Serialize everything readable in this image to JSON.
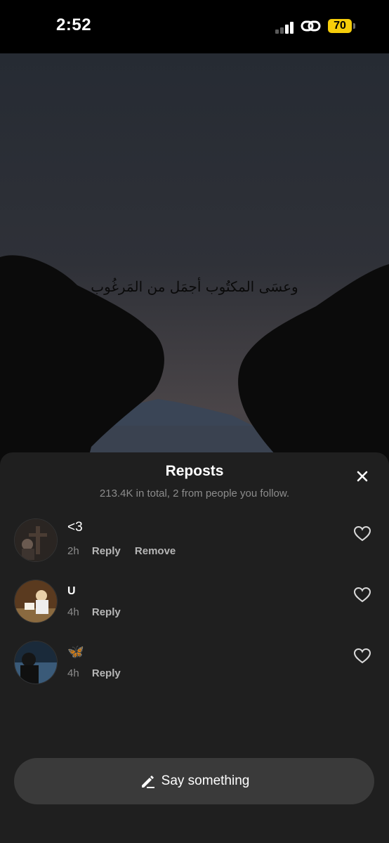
{
  "status_bar": {
    "time": "2:52",
    "battery": "70",
    "icons": [
      "signal-icon",
      "link-icon",
      "battery-icon"
    ]
  },
  "video": {
    "caption": "وعسَى المكتُوب أجمَل من المَرغُوب"
  },
  "sheet": {
    "title": "Reposts",
    "subtitle": "213.4K in total, 2 from people you follow.",
    "close_icon": "close-icon",
    "comments": [
      {
        "text": "<3",
        "time": "2h",
        "actions": [
          "Reply",
          "Remove"
        ]
      },
      {
        "text": "U",
        "time": "4h",
        "actions": [
          "Reply"
        ]
      },
      {
        "text": "🦋",
        "time": "4h",
        "actions": [
          "Reply"
        ]
      }
    ],
    "say_something": "Say something"
  },
  "colors": {
    "sheet_bg": "#1f1f1f",
    "battery": "#f6cd0a",
    "input_bg": "#3a3a3a",
    "muted_text": "#8c8c8c"
  }
}
